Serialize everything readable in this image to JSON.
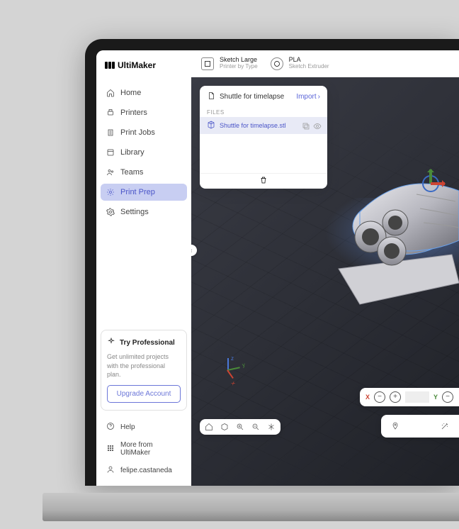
{
  "brand": {
    "name": "UltiMaker"
  },
  "nav": {
    "items": [
      {
        "key": "home",
        "label": "Home"
      },
      {
        "key": "printers",
        "label": "Printers"
      },
      {
        "key": "print-jobs",
        "label": "Print Jobs"
      },
      {
        "key": "library",
        "label": "Library"
      },
      {
        "key": "teams",
        "label": "Teams"
      },
      {
        "key": "print-prep",
        "label": "Print Prep"
      },
      {
        "key": "settings",
        "label": "Settings"
      }
    ],
    "active_index": 5
  },
  "promo": {
    "title": "Try Professional",
    "body": "Get unlimited projects with the professional plan.",
    "cta": "Upgrade Account"
  },
  "footer": {
    "help": "Help",
    "more": "More from UltiMaker",
    "user": "felipe.castaneda"
  },
  "topbar": {
    "printer": {
      "title": "Sketch Large",
      "sub": "Printer by Type"
    },
    "material": {
      "title": "PLA",
      "sub": "Sketch Extruder"
    }
  },
  "panel": {
    "project_name": "Shuttle for timelapse",
    "import_label": "Import",
    "files_label": "FILES",
    "files": [
      {
        "name": "Shuttle for timelapse.stl"
      }
    ]
  },
  "position_bar": {
    "x_label": "X",
    "y_label": "Y",
    "x_value": "",
    "y_value": ""
  },
  "colors": {
    "accent": "#5b65d8",
    "accent_bg": "#c8cef2",
    "axis_x": "#cc4433",
    "axis_y": "#4a8a3a",
    "axis_z": "#4a78d8"
  }
}
